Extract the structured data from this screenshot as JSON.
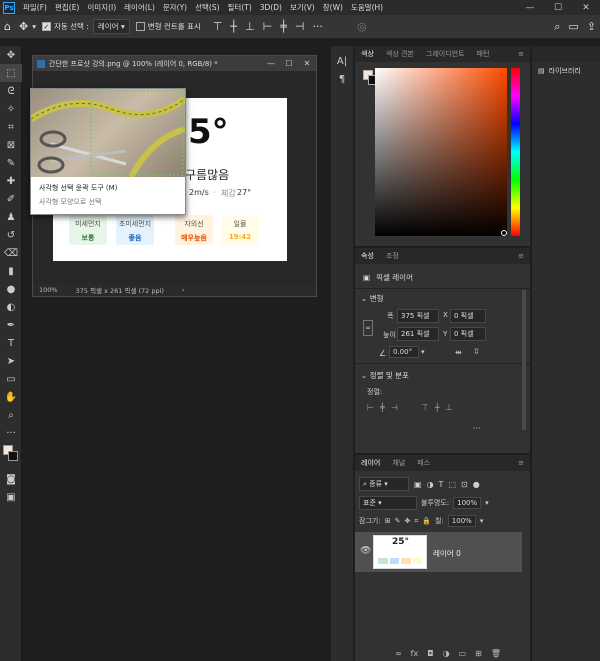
{
  "menubar": {
    "items": [
      "파일(F)",
      "편집(E)",
      "이미지(I)",
      "레이어(L)",
      "문자(Y)",
      "선택(S)",
      "필터(T)",
      "3D(D)",
      "보기(V)",
      "창(W)",
      "도움말(H)"
    ],
    "logo": "Ps"
  },
  "options": {
    "auto_select_label": "자동 선택 :",
    "auto_select_value": "레이어",
    "transform_label": "변형 컨트롤 표시"
  },
  "document": {
    "title": "간단한 프로샷 강의.png @ 100% (레이어 0, RGB/8) *",
    "zoom": "100%",
    "size": "375 픽셀 x 261 픽셀 (72 ppi)",
    "card": {
      "temp_big": "5°",
      "condition": "구름많음",
      "wind": "2m/s",
      "feels_label": "체감",
      "feels_value": "27°",
      "badges": [
        {
          "label": "미세먼지",
          "value": "보통",
          "color": "#2e7d32",
          "bg": "#e8f5e9"
        },
        {
          "label": "초미세먼지",
          "value": "좋음",
          "color": "#1565c0",
          "bg": "#e3f2fd"
        },
        {
          "label": "자외선",
          "value": "매우높음",
          "color": "#e65100",
          "bg": "#fff3e0"
        },
        {
          "label": "일몰",
          "value": "19:42",
          "color": "#f9a825",
          "bg": "#fffde7"
        }
      ]
    }
  },
  "tooltip": {
    "title": "사각형 선택 윤곽 도구 (M)",
    "desc": "사각형 모양으로 선택"
  },
  "color_panel": {
    "tabs": [
      "색상",
      "색상 견본",
      "그레이디언트",
      "패턴"
    ]
  },
  "library": {
    "label": "라이브러리"
  },
  "properties": {
    "tabs": [
      "속성",
      "조정"
    ],
    "type": "픽셀 레이어",
    "transform_title": "변형",
    "w_label": "폭",
    "w_value": "375 픽셀",
    "h_label": "높이",
    "h_value": "261 픽셀",
    "x_label": "X",
    "x_value": "0 픽셀",
    "y_label": "Y",
    "y_value": "0 픽셀",
    "angle_value": "0.00°",
    "align_title": "정렬 및 분포",
    "align_label": "정렬:"
  },
  "layers": {
    "tabs": [
      "레이어",
      "채널",
      "패스"
    ],
    "filter_label": "종류",
    "blend_mode": "표준",
    "opacity_label": "불투명도:",
    "opacity_value": "100%",
    "lock_label": "잠그기:",
    "fill_label": "칠:",
    "fill_value": "100%",
    "layer_name": "레이어 0",
    "thumb_text": "25°"
  },
  "colors": {
    "accent": "#2d8ceb"
  }
}
